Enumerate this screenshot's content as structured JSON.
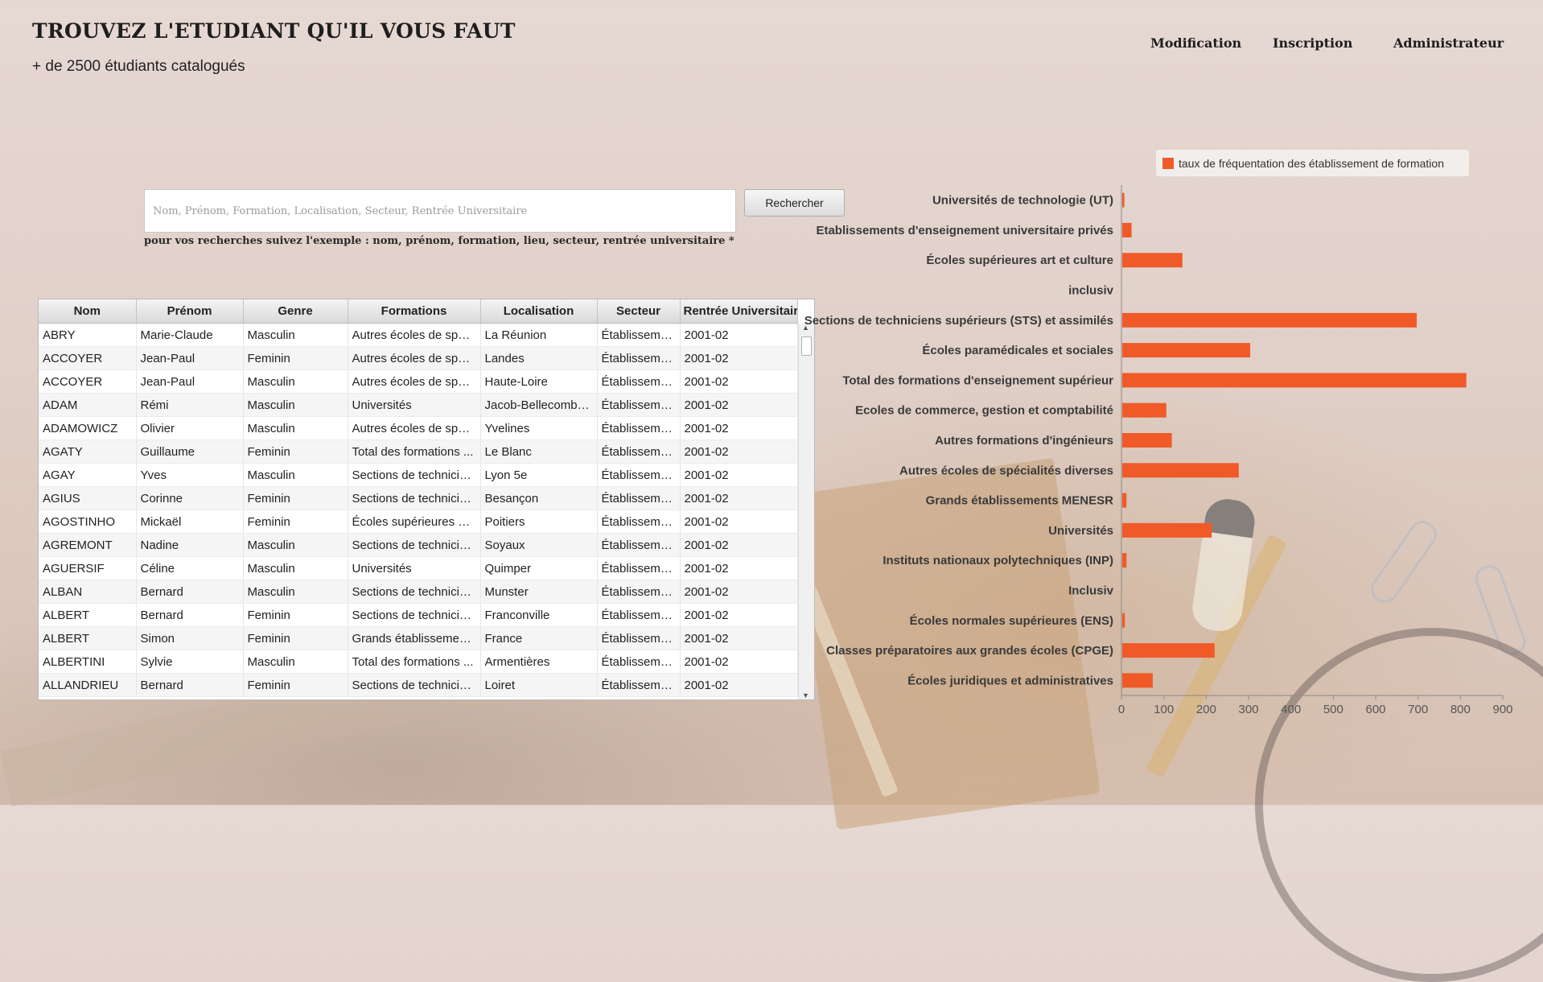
{
  "header": {
    "title": "TROUVEZ L'ETUDIANT QU'IL VOUS FAUT",
    "subtitle": "+ de 2500 étudiants catalogués"
  },
  "nav": {
    "modification": "Modification",
    "inscription": "Inscription",
    "administrateur": "Administrateur"
  },
  "search": {
    "placeholder": "Nom, Prénom, Formation, Localisation, Secteur, Rentrée Universitaire",
    "button": "Rechercher",
    "hint": "pour vos recherches suivez l'exemple : nom, prénom, formation, lieu, secteur, rentrée universitaire *"
  },
  "table": {
    "columns": [
      "Nom",
      "Prénom",
      "Genre",
      "Formations",
      "Localisation",
      "Secteur",
      "Rentrée Universitaire"
    ],
    "rows": [
      [
        "ABRY",
        "Marie-Claude",
        "Masculin",
        "Autres écoles de spéc...",
        "La Réunion",
        "Établisseme...",
        "2001-02"
      ],
      [
        "ACCOYER",
        "Jean-Paul",
        "Feminin",
        "Autres écoles de spéc...",
        "Landes",
        "Établisseme...",
        "2001-02"
      ],
      [
        "ACCOYER",
        "Jean-Paul",
        "Masculin",
        "Autres écoles de spéc...",
        "Haute-Loire",
        "Établisseme...",
        "2001-02"
      ],
      [
        "ADAM",
        "Rémi",
        "Masculin",
        "Universités",
        "Jacob-Bellecombe...",
        "Établisseme...",
        "2001-02"
      ],
      [
        "ADAMOWICZ",
        "Olivier",
        "Masculin",
        "Autres écoles de spéc...",
        "Yvelines",
        "Établisseme...",
        "2001-02"
      ],
      [
        "AGATY",
        "Guillaume",
        "Feminin",
        "Total des formations ...",
        "Le Blanc",
        "Établisseme...",
        "2001-02"
      ],
      [
        "AGAY",
        "Yves",
        "Masculin",
        "Sections de technicie...",
        "Lyon 5e",
        "Établisseme...",
        "2001-02"
      ],
      [
        "AGIUS",
        "Corinne",
        "Feminin",
        "Sections de technicie...",
        "Besançon",
        "Établisseme...",
        "2001-02"
      ],
      [
        "AGOSTINHO",
        "Mickaël",
        "Feminin",
        "Écoles supérieures art...",
        "Poitiers",
        "Établisseme...",
        "2001-02"
      ],
      [
        "AGREMONT",
        "Nadine",
        "Masculin",
        "Sections de technicie...",
        "Soyaux",
        "Établisseme...",
        "2001-02"
      ],
      [
        "AGUERSIF",
        "Céline",
        "Masculin",
        "Universités",
        "Quimper",
        "Établisseme...",
        "2001-02"
      ],
      [
        "ALBAN",
        "Bernard",
        "Masculin",
        "Sections de technicie...",
        "Munster",
        "Établisseme...",
        "2001-02"
      ],
      [
        "ALBERT",
        "Bernard",
        "Feminin",
        "Sections de technicie...",
        "Franconville",
        "Établisseme...",
        "2001-02"
      ],
      [
        "ALBERT",
        "Simon",
        "Feminin",
        "Grands établissement...",
        "France",
        "Établisseme...",
        "2001-02"
      ],
      [
        "ALBERTINI",
        "Sylvie",
        "Masculin",
        "Total des formations ...",
        "Armentières",
        "Établisseme...",
        "2001-02"
      ],
      [
        "ALLANDRIEU",
        "Bernard",
        "Feminin",
        "Sections de technicie...",
        "Loiret",
        "Établisseme...",
        "2001-02"
      ]
    ]
  },
  "chart_data": {
    "type": "bar",
    "orientation": "horizontal",
    "legend": "taux de fréquentation des établissement de formation",
    "legend_position": "top-right",
    "color": "#f05a28",
    "categories": [
      "Universités de technologie (UT)",
      "Etablissements d'enseignement universitaire privés",
      "Écoles supérieures art et culture",
      "inclusiv",
      "Sections de techniciens supérieurs (STS) et assimilés",
      "Écoles paramédicales et sociales",
      "Total des formations d'enseignement supérieur",
      "Ecoles de commerce, gestion et comptabilité",
      "Autres formations d'ingénieurs",
      "Autres écoles de spécialités diverses",
      "Grands établissements MENESR",
      "Universités",
      "Instituts nationaux polytechniques (INP)",
      "Inclusiv",
      "Écoles normales supérieures (ENS)",
      "Classes préparatoires aux grandes écoles (CPGE)",
      "Écoles juridiques et administratives"
    ],
    "values": [
      5,
      22,
      142,
      0,
      695,
      302,
      812,
      104,
      117,
      275,
      10,
      211,
      10,
      0,
      6,
      218,
      72
    ],
    "xlim": [
      0,
      900
    ],
    "xticks": [
      "0",
      "100",
      "200",
      "300",
      "400",
      "500",
      "600",
      "700",
      "800",
      "900"
    ]
  }
}
